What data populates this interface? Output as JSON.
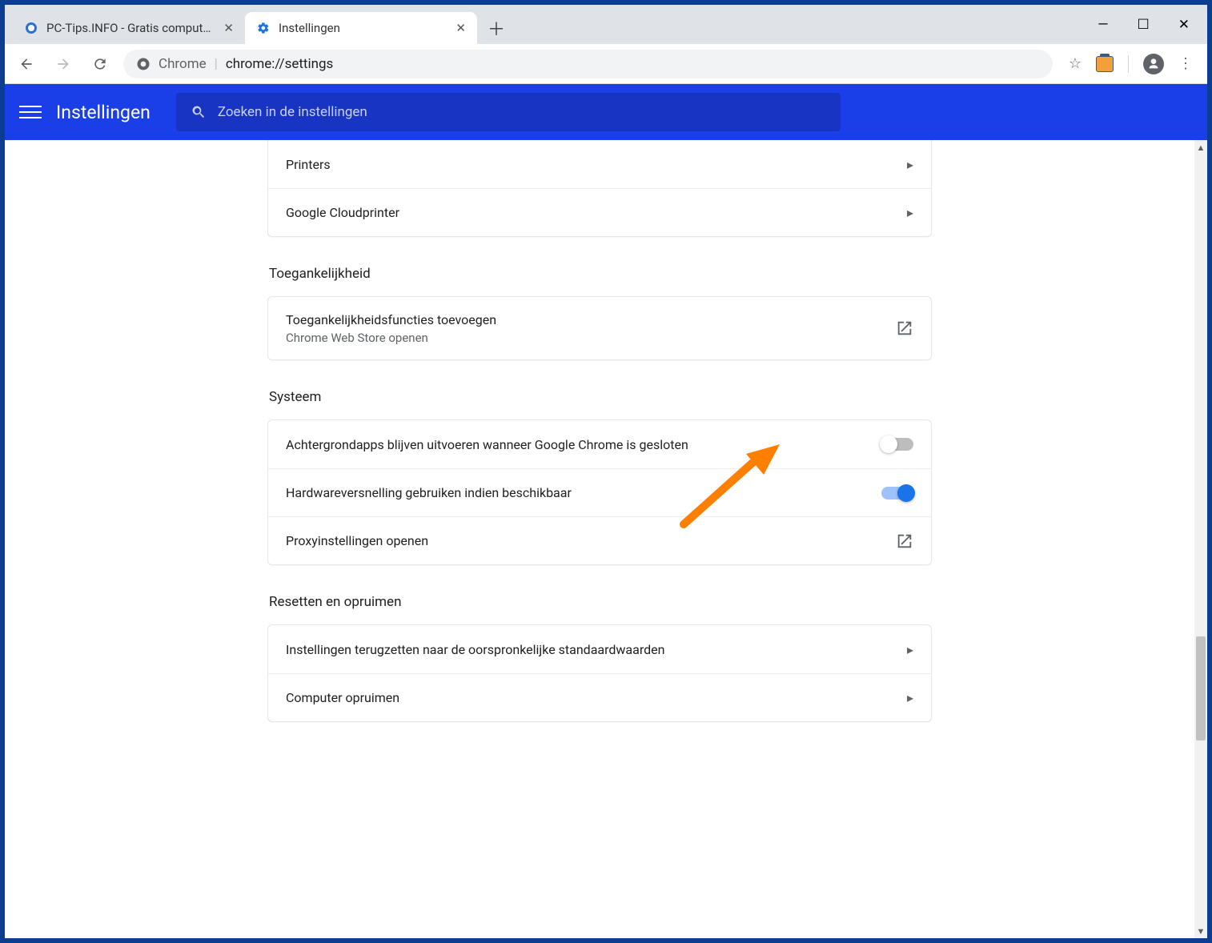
{
  "window": {
    "tabs": [
      {
        "title": "PC-Tips.INFO - Gratis computer t",
        "active": false
      },
      {
        "title": "Instellingen",
        "active": true
      }
    ]
  },
  "urlbar": {
    "scheme_label": "Chrome",
    "url_display": "chrome://settings"
  },
  "app": {
    "title": "Instellingen",
    "search_placeholder": "Zoeken in de instellingen"
  },
  "sections": {
    "printers_card": {
      "items": [
        {
          "label": "Printers"
        },
        {
          "label": "Google Cloudprinter"
        }
      ]
    },
    "accessibility": {
      "title": "Toegankelijkheid",
      "items": [
        {
          "label": "Toegankelijkheidsfuncties toevoegen",
          "sub": "Chrome Web Store openen"
        }
      ]
    },
    "system": {
      "title": "Systeem",
      "items": [
        {
          "label": "Achtergrondapps blijven uitvoeren wanneer Google Chrome is gesloten",
          "toggle": "off"
        },
        {
          "label": "Hardwareversnelling gebruiken indien beschikbaar",
          "toggle": "on"
        },
        {
          "label": "Proxyinstellingen openen",
          "action": "external"
        }
      ]
    },
    "reset": {
      "title": "Resetten en opruimen",
      "items": [
        {
          "label": "Instellingen terugzetten naar de oorspronkelijke standaardwaarden"
        },
        {
          "label": "Computer opruimen"
        }
      ]
    }
  },
  "annotation": {
    "color": "#ff7f00",
    "target_description": "arrow pointing to the off toggle of 'Achtergrondapps blijven uitvoeren'"
  }
}
